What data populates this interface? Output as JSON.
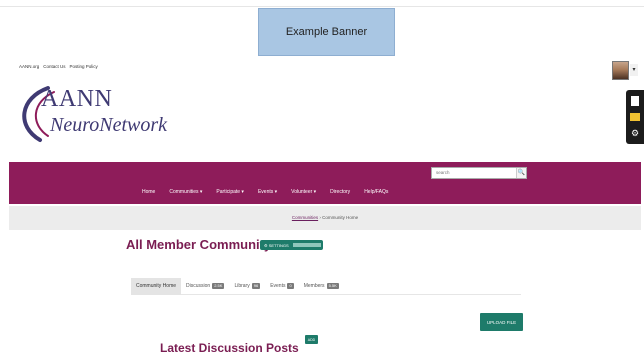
{
  "banner": {
    "text": "Example Banner"
  },
  "utility_links": [
    "AANN.org",
    "Contact Us",
    "Posting Policy"
  ],
  "avatar": {
    "caret": "▾"
  },
  "side_tools": [
    "document-icon",
    "folder-icon",
    "gear-icon"
  ],
  "logo": {
    "line1": "AANN",
    "line2": "NeuroNetwork"
  },
  "search": {
    "placeholder": "search",
    "button": "🔍"
  },
  "nav": {
    "items": [
      "Home",
      "Communities ▾",
      "Participate ▾",
      "Events ▾",
      "Volunteer ▾",
      "Directory",
      "Help/FAQs"
    ]
  },
  "breadcrumb": {
    "link": "Communities",
    "separator": " › ",
    "current": "Community Home"
  },
  "community": {
    "title": "All Member Community",
    "settings_label": "⚙ SETTINGS"
  },
  "tabs": [
    {
      "label": "Community Home",
      "count": ""
    },
    {
      "label": "Discussion",
      "count": "2.5K"
    },
    {
      "label": "Library",
      "count": "96"
    },
    {
      "label": "Events",
      "count": "0"
    },
    {
      "label": "Members",
      "count": "5.5K"
    }
  ],
  "upload": {
    "label": "UPLOAD FILE"
  },
  "latest": {
    "title": "Latest Discussion Posts",
    "add_label": "ADD"
  },
  "colors": {
    "primary_maroon": "#8e1c5a",
    "accent_green": "#1e7b6a",
    "banner_blue": "#a9c6e3",
    "logo_purple": "#3f3a73"
  }
}
